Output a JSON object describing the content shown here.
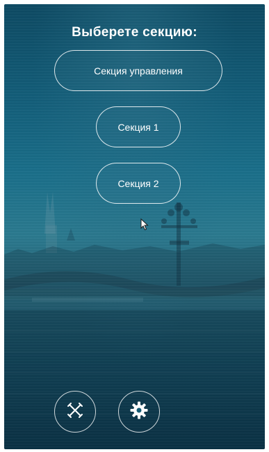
{
  "screen": {
    "title": "Выберете секцию:"
  },
  "buttons": {
    "control_section": "Секция управления",
    "section_1": "Секция 1",
    "section_2": "Секция 2"
  },
  "bottom_bar": {
    "close_icon": "close-tools-icon",
    "settings_icon": "gear-icon"
  },
  "colors": {
    "background_top": "#0d4a63",
    "background_mid": "#1a6f8a",
    "background_bottom": "#0c3347",
    "foreground": "#ffffff"
  }
}
